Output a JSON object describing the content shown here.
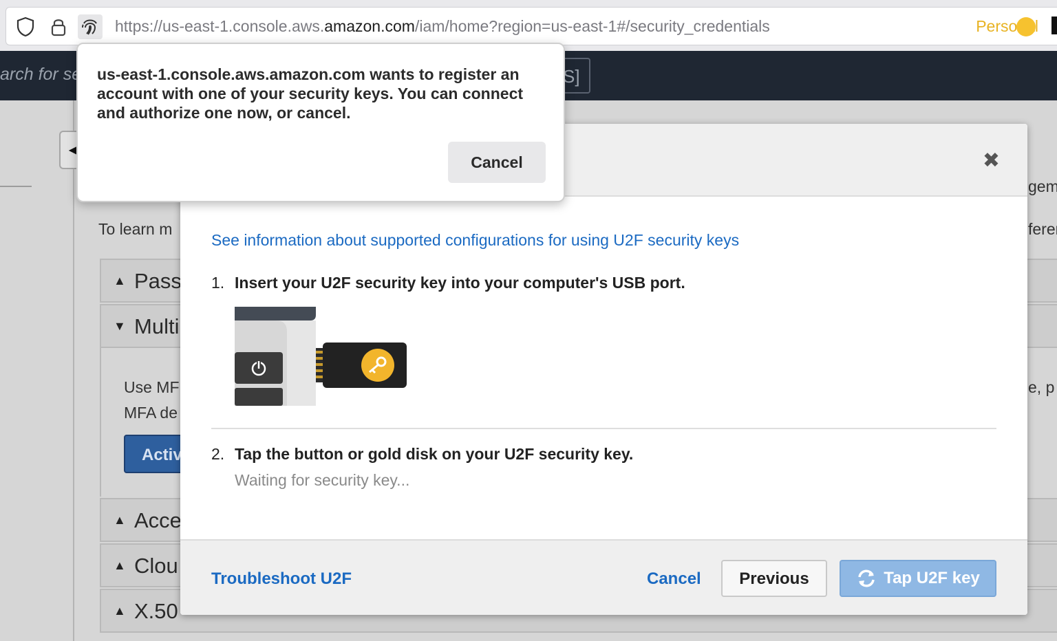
{
  "browser": {
    "url_prefix": "https://us-east-1.console.aws.",
    "url_domain": "amazon.com",
    "url_suffix": "/iam/home?region=us-east-1#/security_credentials",
    "profile_label": "Personal",
    "profile_color": "#f6c22f",
    "icons": [
      "shield-icon",
      "lock-icon",
      "fingerprint-icon"
    ]
  },
  "aws_header": {
    "search_text": "arch for se",
    "shortcut_text": "S]"
  },
  "background_page": {
    "learn_text_left": "To learn m",
    "learn_text_right": "ferer",
    "manage_fragment": "gem",
    "sections": [
      {
        "label": "Pass",
        "expanded": false
      },
      {
        "label": "Multi",
        "expanded": true
      },
      {
        "label": "Acce",
        "expanded": false
      },
      {
        "label": "Clou",
        "expanded": false
      },
      {
        "label": "X.50",
        "expanded": false
      }
    ],
    "mfa_line1": "Use MF",
    "mfa_line2": "MFA de",
    "mfa_right": "e, p",
    "activate_button": "Activ"
  },
  "modal": {
    "info_link": "See information about supported configurations for using U2F security keys",
    "steps": [
      {
        "number": "1.",
        "text": "Insert your U2F security key into your computer's USB port."
      },
      {
        "number": "2.",
        "text": "Tap the button or gold disk on your U2F security key."
      }
    ],
    "waiting_text": "Waiting for security key...",
    "footer": {
      "troubleshoot_link": "Troubleshoot U2F",
      "cancel_link": "Cancel",
      "previous_button": "Previous",
      "tap_button": "Tap U2F key"
    },
    "colors": {
      "link": "#1b6ac2",
      "primary_disabled": "#8fb8e4",
      "key_gold": "#f2b52c"
    }
  },
  "popup": {
    "message": "us-east-1.console.aws.amazon.com wants to register an account with one of your security keys. You can connect and authorize one now, or cancel.",
    "cancel_button": "Cancel"
  }
}
